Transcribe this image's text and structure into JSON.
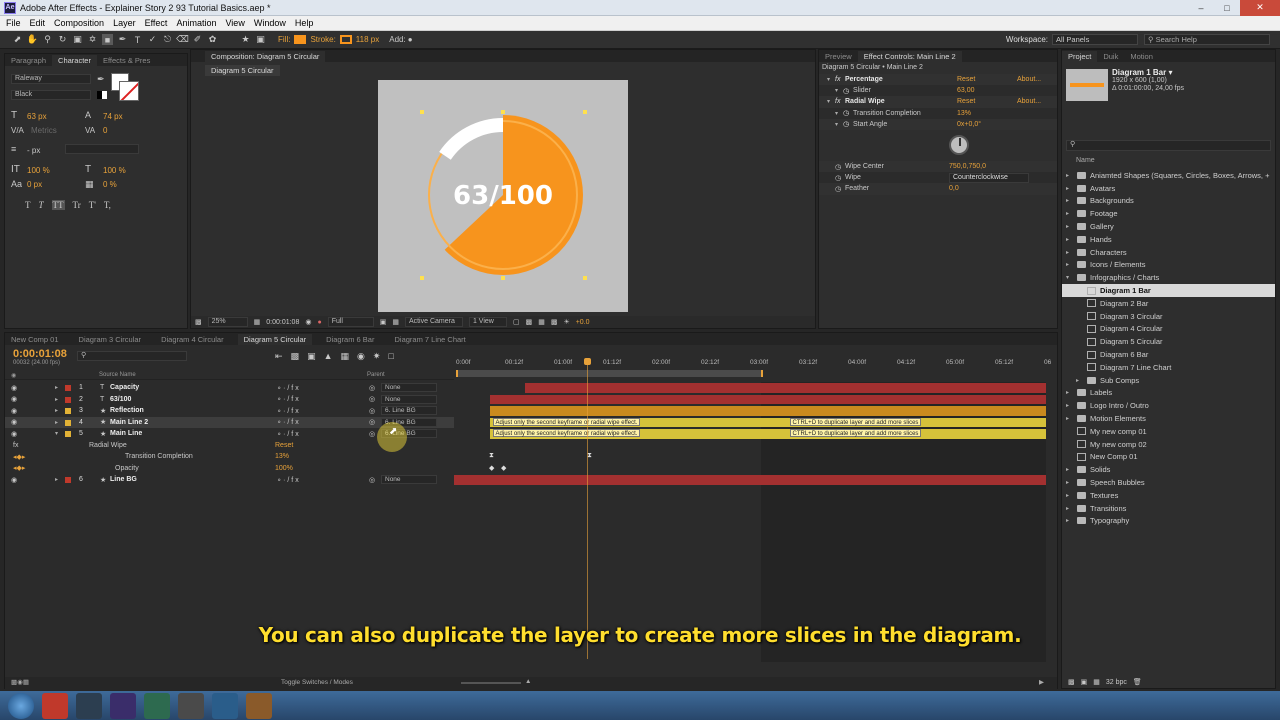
{
  "window": {
    "title": "Adobe After Effects - Explainer Story 2 93 Tutorial Basics.aep *"
  },
  "menu": [
    "File",
    "Edit",
    "Composition",
    "Layer",
    "Effect",
    "Animation",
    "View",
    "Window",
    "Help"
  ],
  "toolbar": {
    "fill_label": "Fill:",
    "stroke_label": "Stroke:",
    "stroke_width": "118 px",
    "add_label": "Add:",
    "workspace_label": "Workspace:",
    "workspace_value": "All Panels",
    "search_placeholder": "Search Help",
    "fill_color": "#f7941d",
    "stroke_color": "#f7941d"
  },
  "left_panel": {
    "tabs": [
      "Paragraph",
      "Character",
      "Effects & Pres"
    ],
    "font_name": "Raleway",
    "font_style": "Black",
    "font_size": "63 px",
    "leading": "74 px",
    "tracking_label": "Metrics",
    "tracking_value": "0",
    "stroke_size": "- px",
    "vscale": "100 %",
    "hscale": "100 %",
    "baseline": "0 px",
    "tsume": "0 %",
    "style_buttons": [
      "T",
      "T",
      "TT",
      "Tr",
      "T'",
      "T,"
    ]
  },
  "composition": {
    "tab": "Composition: Diagram 5 Circular",
    "breadcrumb": "Diagram 5 Circular",
    "label": "63/100",
    "percent": 63,
    "zoom": "25%",
    "timecode": "0:00:01:08",
    "resolution": "Full",
    "camera": "Active Camera",
    "view": "1 View",
    "exposure": "+0.0"
  },
  "effect_controls": {
    "tabs": [
      "Preview",
      "Effect Controls: Main Line 2"
    ],
    "breadcrumb": "Diagram 5 Circular • Main Line 2",
    "rows": [
      {
        "indent": 1,
        "fx": "fx",
        "name": "Percentage",
        "value": "Reset",
        "extra": "About..."
      },
      {
        "indent": 2,
        "fx": "",
        "name": "Slider",
        "value": "63,00",
        "extra": ""
      },
      {
        "indent": 1,
        "fx": "fx",
        "name": "Radial Wipe",
        "value": "Reset",
        "extra": "About..."
      },
      {
        "indent": 2,
        "fx": "",
        "name": "Transition Completion",
        "value": "13%",
        "extra": ""
      },
      {
        "indent": 2,
        "fx": "",
        "name": "Start Angle",
        "value": "0x+0,0°",
        "extra": ""
      }
    ],
    "rows2": [
      {
        "name": "Wipe Center",
        "value": "750,0,750,0"
      },
      {
        "name": "Wipe",
        "value": "Counterclockwise"
      },
      {
        "name": "Feather",
        "value": "0,0"
      }
    ]
  },
  "project": {
    "tabs": [
      "Project",
      "Duik",
      "Motion"
    ],
    "selected_name": "Diagram 1 Bar ▾",
    "selected_dims": "1920 x 600 (1,00)",
    "selected_dur": "Δ 0:01:00:00, 24,00 fps",
    "col_name": "Name",
    "items": [
      {
        "level": 0,
        "type": "folder",
        "open": false,
        "name": "Aniamted Shapes (Squares, Circles, Boxes, Arrows, +"
      },
      {
        "level": 0,
        "type": "folder",
        "open": false,
        "name": "Avatars"
      },
      {
        "level": 0,
        "type": "folder",
        "open": false,
        "name": "Backgrounds"
      },
      {
        "level": 0,
        "type": "folder",
        "open": false,
        "name": "Footage"
      },
      {
        "level": 0,
        "type": "folder",
        "open": false,
        "name": "Gallery"
      },
      {
        "level": 0,
        "type": "folder",
        "open": false,
        "name": "Hands"
      },
      {
        "level": 0,
        "type": "folder",
        "open": false,
        "name": "Characters"
      },
      {
        "level": 0,
        "type": "folder",
        "open": false,
        "name": "Icons / Elements"
      },
      {
        "level": 0,
        "type": "folder",
        "open": true,
        "name": "Infographics / Charts"
      },
      {
        "level": 1,
        "type": "comp",
        "name": "Diagram 1 Bar",
        "selected": true
      },
      {
        "level": 1,
        "type": "comp",
        "name": "Diagram 2 Bar"
      },
      {
        "level": 1,
        "type": "comp",
        "name": "Diagram 3 Circular"
      },
      {
        "level": 1,
        "type": "comp",
        "name": "Diagram 4 Circular"
      },
      {
        "level": 1,
        "type": "comp",
        "name": "Diagram 5 Circular"
      },
      {
        "level": 1,
        "type": "comp",
        "name": "Diagram 6 Bar"
      },
      {
        "level": 1,
        "type": "comp",
        "name": "Diagram 7 Line Chart"
      },
      {
        "level": 1,
        "type": "folder",
        "open": false,
        "name": "Sub Comps"
      },
      {
        "level": 0,
        "type": "folder",
        "open": false,
        "name": "Labels"
      },
      {
        "level": 0,
        "type": "folder",
        "open": false,
        "name": "Logo Intro / Outro"
      },
      {
        "level": 0,
        "type": "folder",
        "open": false,
        "name": "Motion Elements"
      },
      {
        "level": 0,
        "type": "comp",
        "name": "My new comp 01"
      },
      {
        "level": 0,
        "type": "comp",
        "name": "My new comp 02"
      },
      {
        "level": 0,
        "type": "comp",
        "name": "New Comp 01"
      },
      {
        "level": 0,
        "type": "folder",
        "open": false,
        "name": "Solids"
      },
      {
        "level": 0,
        "type": "folder",
        "open": false,
        "name": "Speech Bubbles"
      },
      {
        "level": 0,
        "type": "folder",
        "open": false,
        "name": "Textures"
      },
      {
        "level": 0,
        "type": "folder",
        "open": false,
        "name": "Transitions"
      },
      {
        "level": 0,
        "type": "folder",
        "open": false,
        "name": "Typography"
      }
    ],
    "bpc": "32 bpc"
  },
  "timeline": {
    "tabs": [
      "New Comp 01",
      "Diagram 3 Circular",
      "Diagram 4 Circular",
      "Diagram 5 Circular",
      "Diagram 6 Bar",
      "Diagram 7 Line Chart"
    ],
    "active_tab": 3,
    "timecode": "0:00:01:08",
    "fps": "00032 (24.00 fps)",
    "col_source": "Source Name",
    "col_parent": "Parent",
    "ruler": [
      "0:00f",
      "00:12f",
      "01:00f",
      "01:12f",
      "02:00f",
      "02:12f",
      "03:00f",
      "03:12f",
      "04:00f",
      "04:12f",
      "05:00f",
      "05:12f",
      "06"
    ],
    "layers": [
      {
        "num": "1",
        "name": "Capacity",
        "color": "#c0392b",
        "parent": "None",
        "bar": "#a33030",
        "bar_start": 0.12,
        "bar_end": 1.0,
        "icon": "T"
      },
      {
        "num": "2",
        "name": "63/100",
        "color": "#c0392b",
        "parent": "None",
        "bar": "#a33030",
        "bar_start": 0.06,
        "bar_end": 1.0,
        "icon": "T"
      },
      {
        "num": "3",
        "name": "Reflection",
        "color": "#e2b236",
        "parent": "6. Line BG",
        "bar": "#c98a1e",
        "bar_start": 0.06,
        "bar_end": 1.0,
        "icon": "★"
      },
      {
        "num": "4",
        "name": "Main Line 2",
        "color": "#e2b236",
        "parent": "6. Line BG",
        "bar": "#d6c23a",
        "bar_start": 0.06,
        "bar_end": 1.0,
        "icon": "★",
        "selected": true,
        "note1": "Adjust only the second keyframe or radial wipe effect.",
        "note2": "CTRL+D to duplicate layer and add more slices"
      },
      {
        "num": "5",
        "name": "Main Line",
        "color": "#e2b236",
        "parent": "6. Line BG",
        "bar": "#d6c23a",
        "bar_start": 0.06,
        "bar_end": 1.0,
        "icon": "★",
        "note1": "Adjust only the second keyframe or radial wipe effect.",
        "note2": "CTRL+D to duplicate layer and add more slices"
      }
    ],
    "effect_fx": "fx",
    "effect_name": "Radial Wipe",
    "effect_reset": "Reset",
    "prop1_name": "Transition Completion",
    "prop1_value": "13%",
    "prop2_name": "Opacity",
    "prop2_value": "100%",
    "layer6": {
      "num": "6",
      "name": "Line BG",
      "parent": "None"
    },
    "footer": "Toggle Switches / Modes"
  },
  "subtitle": "You can also duplicate the layer to create more slices in the diagram."
}
